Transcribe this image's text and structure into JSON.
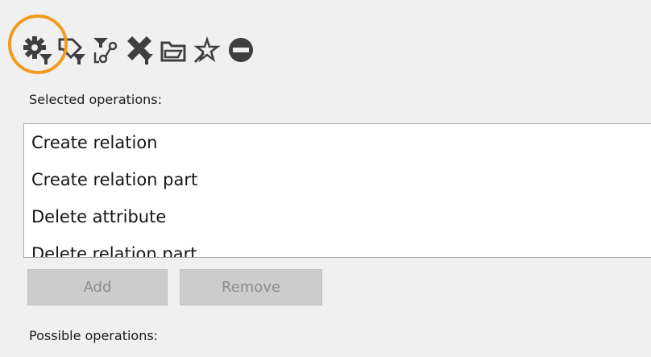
{
  "toolbar": {
    "icons": [
      {
        "name": "operations-filter-icon",
        "highlighted": true
      },
      {
        "name": "type-filter-icon"
      },
      {
        "name": "relation-filter-icon"
      },
      {
        "name": "delete-filter-icon"
      },
      {
        "name": "folder-icon"
      },
      {
        "name": "favorite-icon"
      },
      {
        "name": "remove-icon"
      }
    ],
    "icon_color": "#3f3f3f",
    "highlight_color": "#f39b1e"
  },
  "selected": {
    "label": "Selected operations:",
    "items": [
      "Create relation",
      "Create relation part",
      "Delete attribute",
      "Delete relation part"
    ]
  },
  "buttons": {
    "add_label": "Add",
    "remove_label": "Remove",
    "disabled": true
  },
  "possible": {
    "label": "Possible operations:"
  }
}
